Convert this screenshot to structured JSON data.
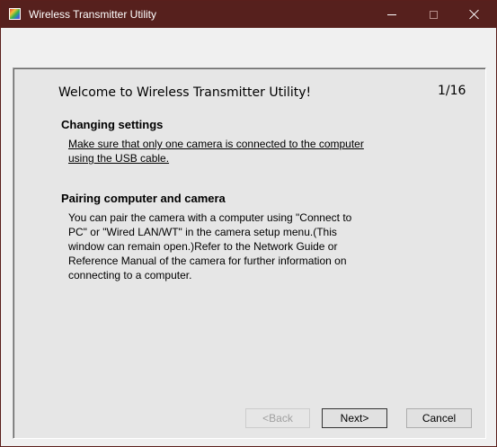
{
  "window": {
    "title": "Wireless Transmitter Utility",
    "controls": {
      "minimize": "minimize",
      "maximize": "maximize",
      "close": "close"
    }
  },
  "content": {
    "heading": "Welcome to Wireless Transmitter Utility!",
    "page_counter": "1/16",
    "section1": {
      "title": "Changing settings",
      "text": "Make sure that only one camera is connected to the computer using the USB cable."
    },
    "section2": {
      "title": "Pairing computer and camera",
      "text": "You can pair the camera with a computer using \"Connect to PC\" or \"Wired LAN/WT\" in the camera setup menu.(This window can remain open.)Refer to the Network Guide or Reference Manual of the camera for further information on connecting to a computer."
    }
  },
  "buttons": {
    "back": "<Back",
    "next": "Next>",
    "cancel": "Cancel"
  },
  "colors": {
    "titlebar": "#56201d",
    "panel": "#e6e6e6"
  }
}
